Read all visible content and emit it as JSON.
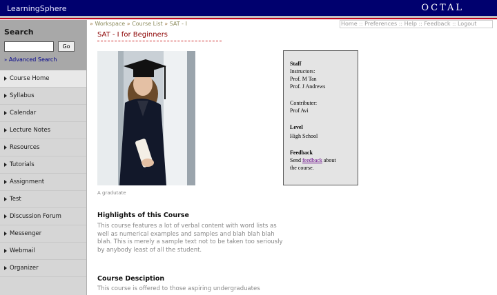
{
  "header": {
    "brand": "LearningSphere",
    "logo_text": "OCTAL"
  },
  "sidebar": {
    "search_title": "Search",
    "search_value": "",
    "go_label": "Go",
    "advanced_search": "Advanced Search",
    "advanced_bullet": "»",
    "items": [
      {
        "label": "Course Home"
      },
      {
        "label": "Syllabus"
      },
      {
        "label": "Calendar"
      },
      {
        "label": "Lecture Notes"
      },
      {
        "label": "Resources"
      },
      {
        "label": "Tutorials"
      },
      {
        "label": "Assignment"
      },
      {
        "label": "Test"
      },
      {
        "label": "Discussion Forum"
      },
      {
        "label": "Messenger"
      },
      {
        "label": "Webmail"
      },
      {
        "label": "Organizer"
      }
    ]
  },
  "breadcrumb": {
    "sep": "»",
    "items": [
      "Workspace",
      "Course List",
      "SAT - I"
    ]
  },
  "toplinks": {
    "sep": "::",
    "items": [
      "Home",
      "Preferences",
      "Help",
      "Feedback",
      "Logout"
    ]
  },
  "course": {
    "title": "SAT - I for Beginners",
    "image_caption": "A gradutate",
    "highlights_title": "Highlights of this Course",
    "highlights_text": "This course features a lot of verbal content with word lists as well as numerical examples and samples and blah blah blah blah. This is merely a sample text not to be taken too seriously by anybody least of all the student.",
    "description_title": "Course Desciption",
    "description_text": "This course is offered to those aspiring undergraduates"
  },
  "staff": {
    "staff_heading": "Staff",
    "instructors_label": "Instructors:",
    "instructor_1": "Prof. M Tan",
    "instructor_2": "Prof. J Andrews",
    "contributer_label": "Contributer:",
    "contributer_1": "Prof Avi",
    "level_heading": "Level",
    "level_value": "High School",
    "feedback_heading": "Feedback",
    "feedback_pre": "Send",
    "feedback_link": "feedback",
    "feedback_post": "about",
    "feedback_tail": "the course."
  }
}
